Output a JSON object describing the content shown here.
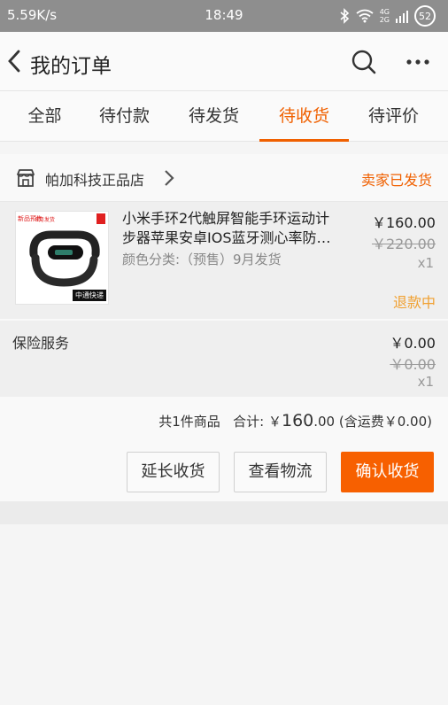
{
  "status_bar": {
    "net_speed": "5.59K/s",
    "time": "18:49",
    "net_top": "4G",
    "net_bottom": "2G",
    "battery": "52",
    "icons": [
      "bluetooth-icon",
      "wifi-icon",
      "signal-icon",
      "battery-icon"
    ]
  },
  "header": {
    "title": "我的订单",
    "icons": [
      "back-arrow-icon",
      "search-icon",
      "more-dots-icon"
    ]
  },
  "tabs": [
    {
      "label": "全部",
      "active": false
    },
    {
      "label": "待付款",
      "active": false
    },
    {
      "label": "待发货",
      "active": false
    },
    {
      "label": "待收货",
      "active": true
    },
    {
      "label": "待评价",
      "active": false
    }
  ],
  "order": {
    "shop_name": "帕加科技正品店",
    "status": "卖家已发货",
    "item": {
      "title": "小米手环2代触屏智能手环运动计步器苹果安卓IOS蓝牙测心率防…",
      "spec": "颜色分类:（预售）9月发货",
      "price": "￥160.00",
      "original_price": "￥220.00",
      "quantity": "x1",
      "refund_status": "退款中",
      "thumb_tag_new": "新品预售",
      "thumb_tag_ship": "8月发货",
      "thumb_courier": "中通快递"
    },
    "insurance": {
      "label": "保险服务",
      "price": "￥0.00",
      "original_price": "￥0.00",
      "quantity": "x1"
    },
    "summary": {
      "count_text": "共1件商品",
      "total_label": "合计:",
      "currency": "￥",
      "total_int": "160",
      "total_dec": ".00",
      "shipping_note": "(含运费￥0.00)"
    },
    "buttons": {
      "extend": "延长收货",
      "track": "查看物流",
      "confirm": "确认收货"
    }
  },
  "colors": {
    "accent": "#f06000",
    "confirm_button": "#f76000",
    "refund": "#f0a030",
    "status_bar": "#8e8e8e"
  }
}
